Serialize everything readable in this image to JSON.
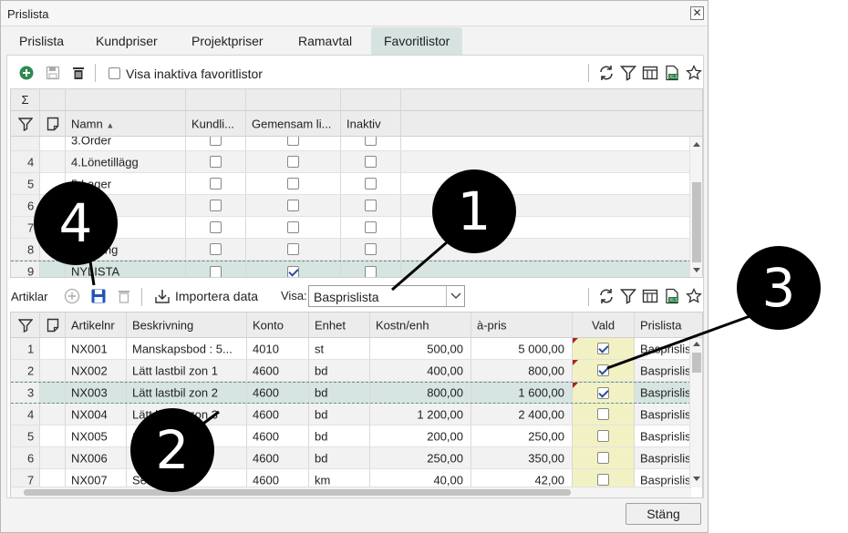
{
  "window": {
    "title": "Prislista",
    "close_glyph": "✕"
  },
  "tabs": [
    {
      "label": "Prislista",
      "active": false
    },
    {
      "label": "Kundpriser",
      "active": false
    },
    {
      "label": "Projektpriser",
      "active": false
    },
    {
      "label": "Ramavtal",
      "active": false
    },
    {
      "label": "Favoritlistor",
      "active": true
    }
  ],
  "fav_toolbar": {
    "show_inactive_label": "Visa inaktiva favoritlistor",
    "show_inactive_checked": false
  },
  "fav_grid": {
    "sum_symbol": "Σ",
    "columns": [
      "Namn",
      "Kundli...",
      "Gemensam li...",
      "Inaktiv"
    ],
    "sort_indicator": "▲",
    "rows": [
      {
        "no": "",
        "name": "3.Order",
        "kund": false,
        "gem": false,
        "inaktiv": false
      },
      {
        "no": "4",
        "name": "4.Lönetillägg",
        "kund": false,
        "gem": false,
        "inaktiv": false
      },
      {
        "no": "5",
        "name": "5.Lager",
        "kund": false,
        "gem": false,
        "inaktiv": false
      },
      {
        "no": "6",
        "name": "",
        "kund": false,
        "gem": false,
        "inaktiv": false
      },
      {
        "no": "7",
        "name": "...ning",
        "kund": false,
        "gem": false,
        "inaktiv": false
      },
      {
        "no": "8",
        "name": "...urering",
        "kund": false,
        "gem": false,
        "inaktiv": false
      },
      {
        "no": "9",
        "name": "NYLISTA",
        "kund": false,
        "gem": true,
        "inaktiv": false,
        "selected": true
      }
    ]
  },
  "art_toolbar": {
    "label": "Artiklar",
    "import_label": "Importera data",
    "visa_label": "Visa:",
    "visa_value": "Basprislista"
  },
  "art_grid": {
    "columns": [
      "Artikelnr",
      "Beskrivning",
      "Konto",
      "Enhet",
      "Kostn/enh",
      "à-pris",
      "Vald",
      "Prislista"
    ],
    "rows": [
      {
        "no": "1",
        "artnr": "NX001",
        "beskr": "Manskapsbod : 5...",
        "konto": "4010",
        "enhet": "st",
        "kostn": "500,00",
        "apris": "5 000,00",
        "vald": true,
        "marker": true,
        "prislista": "Basprislis"
      },
      {
        "no": "2",
        "artnr": "NX002",
        "beskr": "Lätt lastbil zon 1",
        "konto": "4600",
        "enhet": "bd",
        "kostn": "400,00",
        "apris": "800,00",
        "vald": true,
        "marker": true,
        "prislista": "Basprislis"
      },
      {
        "no": "3",
        "artnr": "NX003",
        "beskr": "Lätt lastbil zon 2",
        "konto": "4600",
        "enhet": "bd",
        "kostn": "800,00",
        "apris": "1 600,00",
        "vald": true,
        "marker": true,
        "prislista": "Basprislis",
        "selected": true
      },
      {
        "no": "4",
        "artnr": "NX004",
        "beskr": "Lätt lastbil zon 3",
        "konto": "4600",
        "enhet": "bd",
        "kostn": "1 200,00",
        "apris": "2 400,00",
        "vald": false,
        "marker": false,
        "prislista": "Basprislis"
      },
      {
        "no": "5",
        "artnr": "NX005",
        "beskr": "Se... zon z...",
        "konto": "4600",
        "enhet": "bd",
        "kostn": "200,00",
        "apris": "250,00",
        "vald": false,
        "marker": false,
        "prislista": "Basprislis"
      },
      {
        "no": "6",
        "artnr": "NX006",
        "beskr": "Se... zon z...",
        "konto": "4600",
        "enhet": "bd",
        "kostn": "250,00",
        "apris": "350,00",
        "vald": false,
        "marker": false,
        "prislista": "Basprislis"
      },
      {
        "no": "7",
        "artnr": "NX007",
        "beskr": "Se...gn km",
        "konto": "4600",
        "enhet": "km",
        "kostn": "40,00",
        "apris": "42,00",
        "vald": false,
        "marker": false,
        "prislista": "Basprislis"
      }
    ]
  },
  "footer": {
    "close_label": "Stäng"
  },
  "callouts": [
    "1",
    "2",
    "3",
    "4"
  ],
  "colors": {
    "accent_tab": "#d6e3e1",
    "selected_row": "#d6e5e1",
    "vald_column": "#f1f1c4",
    "add_icon": "#2f8a4e",
    "save_icon": "#2253b8"
  }
}
